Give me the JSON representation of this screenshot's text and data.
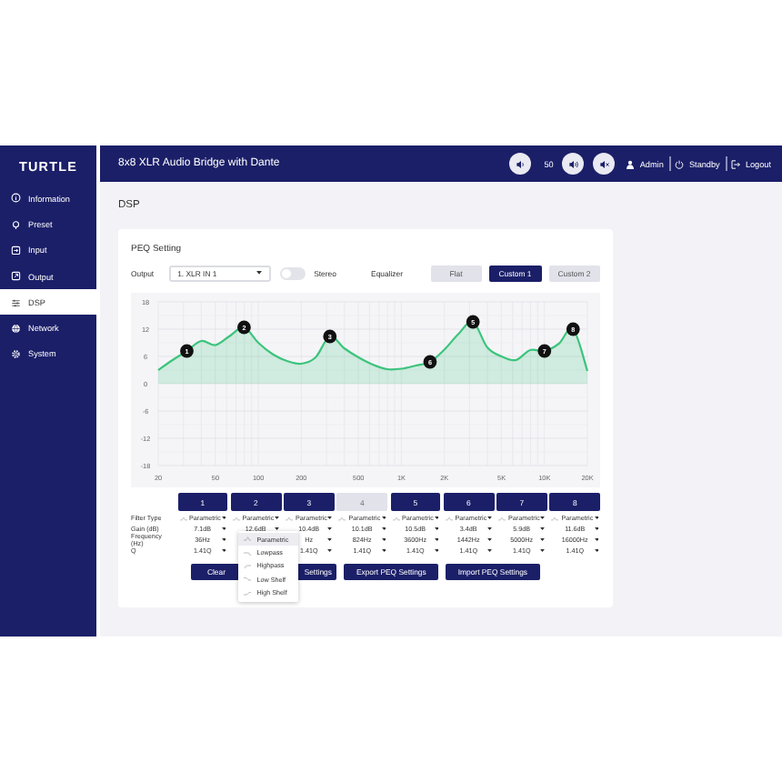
{
  "sidebar": {
    "logo": "TURTLE",
    "items": [
      {
        "label": "Information",
        "selected": false
      },
      {
        "label": "Preset",
        "selected": false
      },
      {
        "label": "Input",
        "selected": false
      },
      {
        "label": "Output",
        "selected": false
      },
      {
        "label": "DSP",
        "selected": true
      },
      {
        "label": "Network",
        "selected": false
      },
      {
        "label": "System",
        "selected": false
      }
    ]
  },
  "header": {
    "title": "8x8 XLR Audio Bridge with Dante",
    "volume": "50",
    "user": "Admin",
    "standby": "Standby",
    "logout": "Logout"
  },
  "page_title": "DSP",
  "peq": {
    "title": "PEQ Setting",
    "output_label": "Output",
    "output_value": "1. XLR IN 1",
    "stereo": {
      "label": "Stereo",
      "on": false
    },
    "equalizer_label": "Equalizer",
    "presets": [
      {
        "label": "Flat",
        "selected": false
      },
      {
        "label": "Custom 1",
        "selected": true
      },
      {
        "label": "Custom 2",
        "selected": false
      }
    ],
    "chart_data": {
      "type": "area",
      "categories": [
        "20",
        null,
        null,
        null,
        "50",
        null,
        null,
        "100",
        null,
        null,
        "200",
        null,
        null,
        null,
        "500",
        null,
        null,
        "1K",
        null,
        null,
        "2K",
        null,
        null,
        null,
        "5K",
        null,
        null,
        "10K",
        null,
        null,
        "20K"
      ],
      "series": [
        {
          "color": "#3cc47c",
          "values": [
            3,
            5.2,
            7.2,
            9.4,
            8.5,
            10.5,
            12.4,
            9,
            6.5,
            5,
            4.4,
            5.8,
            10.4,
            7.8,
            5.8,
            4.2,
            3.2,
            3.3,
            4,
            4.8,
            7.5,
            11,
            13.6,
            8,
            6,
            5.2,
            7.4,
            7.2,
            8.8,
            12,
            2.8
          ]
        }
      ],
      "ylim": [
        -18,
        18
      ],
      "grid": true,
      "yticks": [
        18,
        12,
        6,
        0,
        -6,
        -12,
        -18
      ],
      "annotations": [
        {
          "text": "1",
          "y": 7.2
        },
        {
          "text": "2",
          "y": 12.4
        },
        {
          "text": "3",
          "y": 10.4
        },
        {
          "text": "6",
          "y": 4.8
        },
        {
          "text": "5",
          "y": 13.6
        },
        {
          "text": "7",
          "y": 7.2
        },
        {
          "text": "8",
          "y": 12
        }
      ]
    },
    "row_labels": [
      "Filter Type",
      "Gain (dB)",
      "Frequency (Hz)",
      "Q"
    ],
    "bands": [
      {
        "label": "1",
        "enabled": true,
        "filter_type": "Parametric",
        "gain": "7.1dB",
        "frequency": "36Hz",
        "q": "1.41Q"
      },
      {
        "label": "2",
        "enabled": true,
        "filter_type": "Parametric",
        "gain": "12.6dB",
        "menu": [
          {
            "label": "Parametric",
            "selected": true
          },
          {
            "label": "Lowpass",
            "selected": false
          },
          {
            "label": "Highpass",
            "selected": false
          },
          {
            "label": "Low Shelf",
            "selected": false
          },
          {
            "label": "High Shelf",
            "selected": false
          }
        ]
      },
      {
        "label": "3",
        "enabled": true,
        "filter_type": "Parametric",
        "gain": "10.4dB",
        "frequency": "Hz",
        "q": "1.41Q"
      },
      {
        "label": "4",
        "enabled": false,
        "filter_type": "Parametric",
        "gain": "10.1dB",
        "frequency": "824Hz",
        "q": "1.41Q"
      },
      {
        "label": "5",
        "enabled": true,
        "filter_type": "Parametric",
        "gain": "10.5dB",
        "frequency": "3600Hz",
        "q": "1.41Q"
      },
      {
        "label": "6",
        "enabled": true,
        "filter_type": "Parametric",
        "gain": "3.4dB",
        "frequency": "1442Hz",
        "q": "1.41Q"
      },
      {
        "label": "7",
        "enabled": true,
        "filter_type": "Parametric",
        "gain": "5.9dB",
        "frequency": "5000Hz",
        "q": "1.41Q"
      },
      {
        "label": "8",
        "enabled": true,
        "filter_type": "Parametric",
        "gain": "11.6dB",
        "frequency": "16000Hz",
        "q": "1.41Q"
      }
    ],
    "actions": [
      "Clear",
      "Settings",
      "Export PEQ Settings",
      "Import PEQ Settings"
    ]
  }
}
